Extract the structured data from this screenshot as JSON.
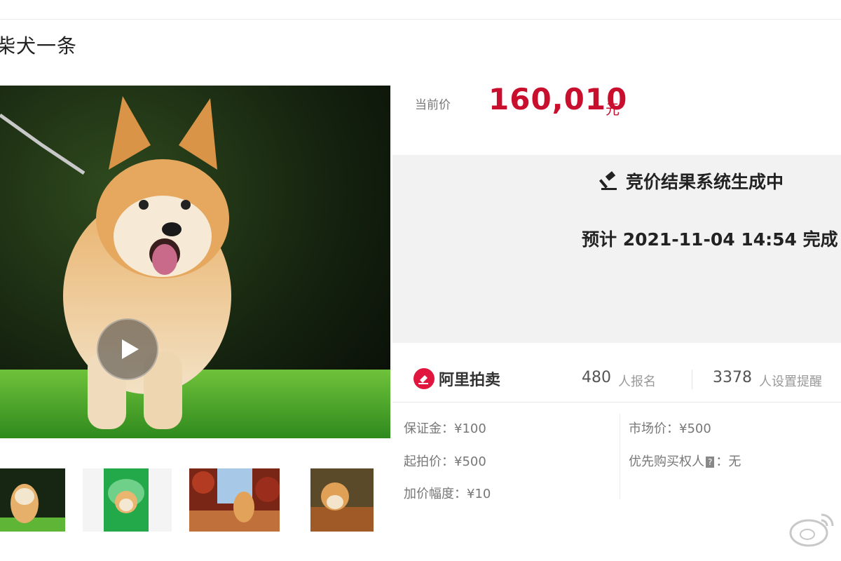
{
  "title": "柴犬一条",
  "price": {
    "label": "当前价",
    "value": "160,010",
    "unit": "元"
  },
  "status": {
    "title": "竞价结果系统生成中",
    "eta": "预计 2021-11-04 14:54 完成"
  },
  "platform": {
    "name": "阿里拍卖",
    "registered_count": "480",
    "registered_label": "人报名",
    "reminder_count": "3378",
    "reminder_label": "人设置提醒"
  },
  "details": {
    "deposit": "保证金：¥100",
    "starting_price": "起拍价：¥500",
    "increment": "加价幅度：¥10",
    "market_price": "市场价：¥500",
    "priority_buyer_label": "优先购买权人",
    "priority_buyer_value": "：无"
  },
  "icons": {
    "play": "play-icon",
    "gavel": "gavel-icon",
    "brand_logo": "auction-logo-icon",
    "watermark": "weibo-watermark-icon"
  },
  "colors": {
    "price": "#c8102e",
    "panel": "#f2f2f2",
    "brand": "#e0163f"
  }
}
